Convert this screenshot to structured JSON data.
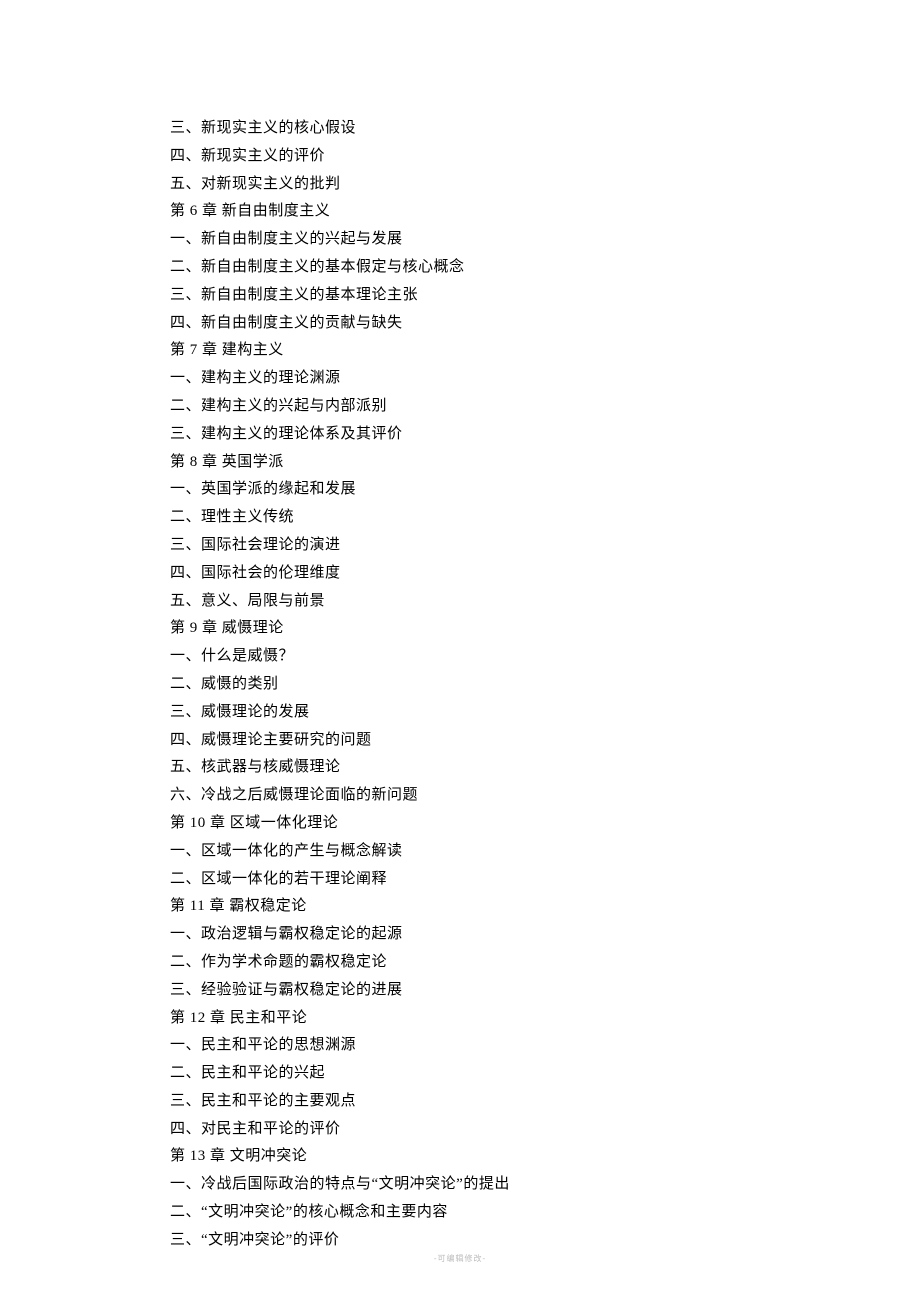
{
  "lines": [
    "三、新现实主义的核心假设",
    "四、新现实主义的评价",
    "五、对新现实主义的批判",
    "第 6 章  新自由制度主义",
    "一、新自由制度主义的兴起与发展",
    "二、新自由制度主义的基本假定与核心概念",
    "三、新自由制度主义的基本理论主张",
    "四、新自由制度主义的贡献与缺失",
    "第 7 章  建构主义",
    "一、建构主义的理论渊源",
    "二、建构主义的兴起与内部派别",
    "三、建构主义的理论体系及其评价",
    "第 8 章  英国学派",
    "一、英国学派的缘起和发展",
    "二、理性主义传统",
    "三、国际社会理论的演进",
    "四、国际社会的伦理维度",
    "五、意义、局限与前景",
    "第 9 章  威慑理论",
    "一、什么是威慑？",
    "二、威慑的类别",
    "三、威慑理论的发展",
    "四、威慑理论主要研究的问题",
    "五、核武器与核威慑理论",
    "六、冷战之后威慑理论面临的新问题",
    "第 10 章  区域一体化理论",
    "一、区域一体化的产生与概念解读",
    "二、区域一体化的若干理论阐释",
    "第 11 章  霸权稳定论",
    "一、政治逻辑与霸权稳定论的起源",
    "二、作为学术命题的霸权稳定论",
    "三、经验验证与霸权稳定论的进展",
    "第 12 章  民主和平论",
    "一、民主和平论的思想渊源",
    "二、民主和平论的兴起",
    "三、民主和平论的主要观点",
    "四、对民主和平论的评价",
    "第 13 章  文明冲突论",
    "一、冷战后国际政治的特点与“文明冲突论”的提出",
    "二、“文明冲突论”的核心概念和主要内容",
    "三、“文明冲突论”的评价"
  ],
  "footer": "-可编辑修改-"
}
